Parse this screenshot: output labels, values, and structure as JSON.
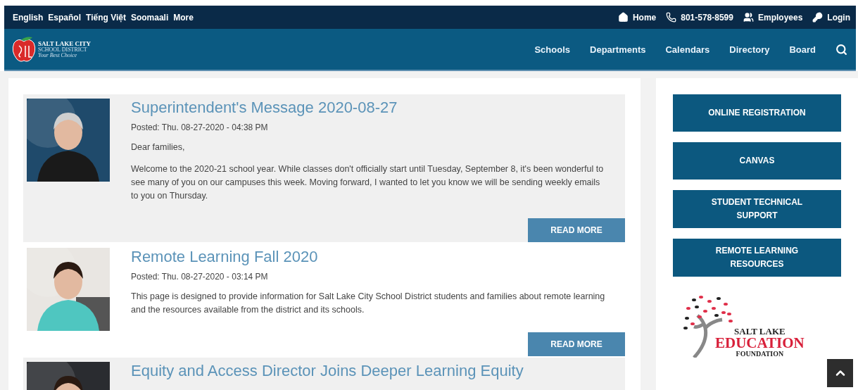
{
  "top_bar": {
    "languages": [
      "English",
      "Español",
      "Tiếng Việt",
      "Soomaali",
      "More"
    ],
    "links": [
      {
        "kind": "home",
        "label": "Home"
      },
      {
        "kind": "phone",
        "label": "801-578-8599"
      },
      {
        "kind": "people",
        "label": "Employees"
      },
      {
        "kind": "key",
        "label": "Login"
      }
    ]
  },
  "header": {
    "logo": {
      "name": "SALT LAKE CITY",
      "subtitle": "SCHOOL DISTRICT",
      "tagline": "Your Best Choice"
    },
    "nav": [
      "Schools",
      "Departments",
      "Calendars",
      "Directory",
      "Board"
    ]
  },
  "articles": [
    {
      "title": "Superintendent's Message 2020-08-27",
      "posted": "Posted: Thu. 08-27-2020 - 04:38 PM",
      "shaded": true,
      "paragraphs": [
        "Dear families,",
        "Welcome to the 2020-21 school year. While classes don't officially start until Tuesday, September 8, it's been wonderful to see many of you on our campuses this week. Moving forward, I wanted to let you know we will be sending weekly emails to you on Thursday."
      ],
      "button": "READ MORE",
      "image": {
        "kind": "picture"
      }
    },
    {
      "title": "Remote Learning Fall 2020",
      "posted": "Posted: Thu. 08-27-2020 - 03:14 PM",
      "shaded": false,
      "paragraphs": [
        "This page is designed to provide information for Salt Lake City School District students and families about remote learning and the resources available from the district and its schools."
      ],
      "button": "READ MORE",
      "image": {
        "kind": "picture"
      }
    },
    {
      "title": "Equity and Access Director Joins Deeper Learning Equity",
      "shaded": true,
      "image": {
        "kind": "picture"
      }
    }
  ],
  "sidebar": {
    "buttons": [
      "ONLINE REGISTRATION",
      "CANVAS",
      "STUDENT TECHNICAL SUPPORT",
      "REMOTE LEARNING RESOURCES"
    ],
    "foundation_logo": {
      "line_1": "SALT LAKE",
      "line_2": "EDUCATION",
      "line_3": "FOUNDATION"
    }
  }
}
